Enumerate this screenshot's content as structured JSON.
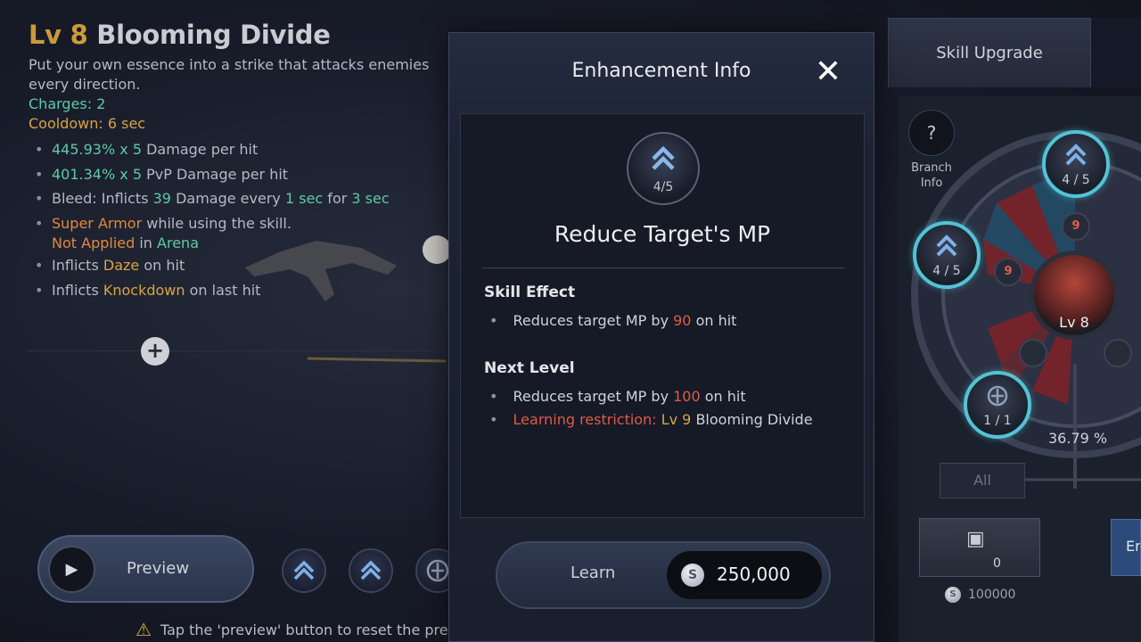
{
  "skill": {
    "level": "Lv 8",
    "name": "Blooming Divide",
    "description": "Put your own essence into a strike that attacks enemies every direction.",
    "charges_label": "Charges:",
    "charges_value": "2",
    "cooldown_label": "Cooldown:",
    "cooldown_value": "6 sec",
    "bullets": {
      "dmg_value": "445.93% x 5",
      "dmg_text": " Damage per hit",
      "pvp_value": "401.34% x 5",
      "pvp_text": " PvP Damage per hit",
      "bleed_a": "Bleed: Inflicts ",
      "bleed_b": "39",
      "bleed_c": " Damage every ",
      "bleed_d": "1 sec",
      "bleed_e": " for ",
      "bleed_f": "3 sec",
      "armor_a": "Super Armor",
      "armor_b": " while using the skill.",
      "armor_c": "Not Applied",
      "armor_d": " in ",
      "armor_e": "Arena",
      "daze_a": "Inflicts ",
      "daze_b": "Daze",
      "daze_c": " on hit",
      "kd_a": "Inflicts ",
      "kd_b": "Knockdown",
      "kd_c": " on last hit"
    }
  },
  "controls": {
    "plus_glyph": "+",
    "play_glyph": "▶",
    "preview_label": "Preview",
    "hint": "Tap the 'preview' button to reset the preview."
  },
  "modal": {
    "title": "Enhancement Info",
    "close_glyph": "✕",
    "badge_count": "4/5",
    "enhancement_name": "Reduce Target's MP",
    "skill_effect_head": "Skill Effect",
    "effect_a": "Reduces target MP by ",
    "effect_b": "90",
    "effect_c": " on hit",
    "next_level_head": "Next Level",
    "next_a": "Reduces target MP by ",
    "next_b": "100",
    "next_c": " on hit",
    "restrict_a": "Learning restriction: ",
    "restrict_b": "Lv 9",
    "restrict_c": " Blooming Divide",
    "learn_label": "Learn",
    "coin_glyph": "S",
    "cost": "250,000"
  },
  "tree": {
    "tab_label": "Skill Upgrade",
    "branch_glyph": "?",
    "branch_label": "Branch Info",
    "node_top_count": "4 / 5",
    "node_left_count": "4 / 5",
    "node_bottom_count": "1 / 1",
    "mini_a": "9",
    "mini_b": "9",
    "center_level": "Lv 8",
    "percent": "36.79 %",
    "all_label": "All",
    "slot_qty": "0",
    "slot_cost": "100000",
    "edge_label": "En"
  },
  "colors": {
    "accent_teal": "#5fc9a6",
    "accent_gold": "#d9a441",
    "accent_red": "#e05a45",
    "node_ring": "#53c3d6"
  }
}
